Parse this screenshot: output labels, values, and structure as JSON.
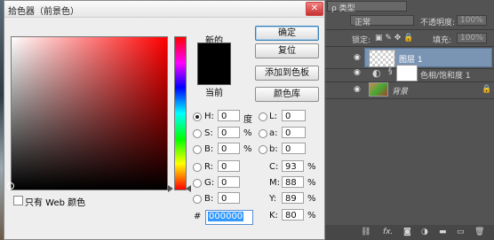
{
  "dialog": {
    "title": "拾色器（前景色）",
    "close_glyph": "✕",
    "label_new": "新的",
    "label_current": "当前",
    "buttons": {
      "ok": "确定",
      "reset": "复位",
      "add_to_swatches": "添加到色板",
      "color_libraries": "颜色库"
    },
    "fields": {
      "H": {
        "label": "H:",
        "value": "0",
        "unit": "度"
      },
      "S": {
        "label": "S:",
        "value": "0",
        "unit": "%"
      },
      "B": {
        "label": "B:",
        "value": "0",
        "unit": "%"
      },
      "R": {
        "label": "R:",
        "value": "0"
      },
      "G": {
        "label": "G:",
        "value": "0"
      },
      "Bl": {
        "label": "B:",
        "value": "0"
      },
      "L": {
        "label": "L:",
        "value": "0"
      },
      "a": {
        "label": "a:",
        "value": "0"
      },
      "b": {
        "label": "b:",
        "value": "0"
      },
      "C": {
        "label": "C:",
        "value": "93",
        "unit": "%"
      },
      "M": {
        "label": "M:",
        "value": "88",
        "unit": "%"
      },
      "Y": {
        "label": "Y:",
        "value": "89",
        "unit": "%"
      },
      "K": {
        "label": "K:",
        "value": "80",
        "unit": "%"
      }
    },
    "hex_label": "#",
    "hex_value": "000000",
    "web_only_label": "只有 Web 颜色",
    "current_color": "#000000"
  },
  "layers_panel": {
    "kind_label": "ρ 类型",
    "blend_mode": "正常",
    "opacity_label": "不透明度:",
    "opacity_value": "100%",
    "lock_label": "锁定:",
    "fill_label": "填充:",
    "fill_value": "100%",
    "layers": [
      {
        "name": "图层 1"
      },
      {
        "name": "色相/饱和度 1"
      },
      {
        "name": "背景"
      }
    ]
  }
}
